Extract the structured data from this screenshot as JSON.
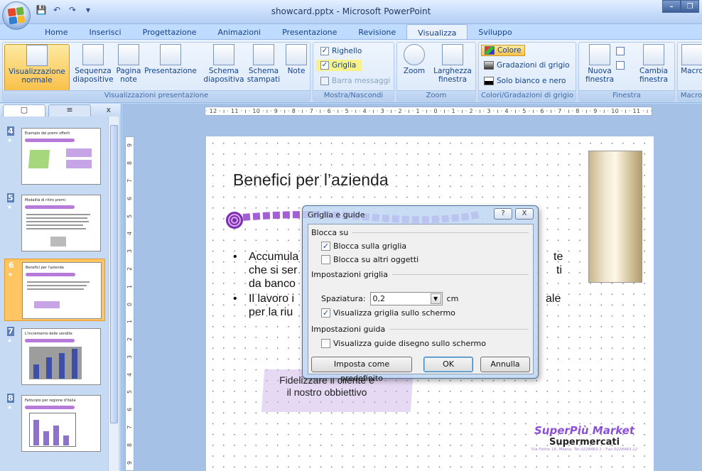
{
  "window": {
    "title": "showcard.pptx - Microsoft PowerPoint"
  },
  "tabs": [
    "Home",
    "Inserisci",
    "Progettazione",
    "Animazioni",
    "Presentazione",
    "Revisione",
    "Visualizza",
    "Sviluppo"
  ],
  "active_tab": "Visualizza",
  "ribbon": {
    "groups": {
      "presentation_views": "Visualizzazioni presentazione",
      "show_hide": "Mostra/Nascondi",
      "zoom": "Zoom",
      "color": "Colori/Gradazioni di grigio",
      "window": "Finestra",
      "macro": "Macro"
    },
    "buttons": {
      "normal_1": "Visualizzazione",
      "normal_2": "normale",
      "sorter_1": "Sequenza",
      "sorter_2": "diapositive",
      "notes_1": "Pagina",
      "notes_2": "note",
      "slideshow": "Presentazione",
      "slide_master_1": "Schema",
      "slide_master_2": "diapositiva",
      "handout_master_1": "Schema",
      "handout_master_2": "stampati",
      "notes_master": "Note",
      "ruler": "Righello",
      "gridlines": "Griglia",
      "message_bar": "Barra messaggi",
      "zoom": "Zoom",
      "fit_1": "Larghezza",
      "fit_2": "finestra",
      "color": "Colore",
      "grayscale": "Gradazioni di grigio",
      "bw": "Solo bianco e nero",
      "new_window_1": "Nuova",
      "new_window_2": "finestra",
      "switch_1": "Cambia",
      "switch_2": "finestra",
      "macro": "Macro"
    }
  },
  "panel": {
    "close": "x",
    "slides": [
      {
        "num": "4",
        "title": "Esempio dei premi offerti"
      },
      {
        "num": "5",
        "title": "Modalità di ritiro premi"
      },
      {
        "num": "6",
        "title": "Benefici per l'azienda"
      },
      {
        "num": "7",
        "title": "L'incremento delle vendite"
      },
      {
        "num": "8",
        "title": "Fatturato per regione d'Italia"
      }
    ],
    "selected": 2
  },
  "ruler": "· 12 · ı · 11 · ı · 10 · ı · 9 · ı · 8 · ı · 7 · ı · 6 · ı · 5 · ı · 4 · ı · 3 · ı · 2 · ı · 1 · ı · 0 · ı · 1 · ı · 2 · ı · 3 · ı · 4 · ı · 5 · ı · 6 · ı · 7 · ı · 8 · ı · 9 · ı · 10 · ı · 11 · ı · 12 ·",
  "vruler": [
    "9",
    "8",
    "7",
    "6",
    "5",
    "4",
    "3",
    "2",
    "1",
    "0",
    "1",
    "2",
    "3",
    "4",
    "5",
    "6",
    "7",
    "8",
    "9"
  ],
  "slide": {
    "title": "Benefici per l’azienda",
    "bullet1_l1": "Accumula",
    "bullet1_l1_end": "te",
    "bullet1_l2": "che si ser",
    "bullet1_l2_end": "ti",
    "bullet1_l3": "da banco",
    "bullet2_l1": "Il lavoro i",
    "bullet2_l1_end": "ale",
    "bullet2_l2": "per la riu",
    "callout": "Fidelizzare il cliente è il nostro obbiettivo",
    "brand_name": "SuperPiù Market",
    "brand_sub": "Supermercati",
    "brand_address": "Via Feltre 16, Milano. Tel 0228463.1 - Fax 0228463.12"
  },
  "dialog": {
    "title": "Griglia e guide",
    "help": "?",
    "close": "X",
    "snap_section": "Blocca su",
    "snap_grid": "Blocca sulla griglia",
    "snap_objects": "Blocca su altri oggetti",
    "grid_section": "Impostazioni griglia",
    "spacing_label": "Spaziatura:",
    "spacing_value": "0,2",
    "spacing_unit": "cm",
    "show_grid": "Visualizza griglia sullo schermo",
    "guide_section": "Impostazioni guida",
    "show_guides": "Visualizza guide disegno sullo schermo",
    "default_btn": "Imposta come predefinito",
    "ok_btn": "OK",
    "cancel_btn": "Annulla"
  }
}
